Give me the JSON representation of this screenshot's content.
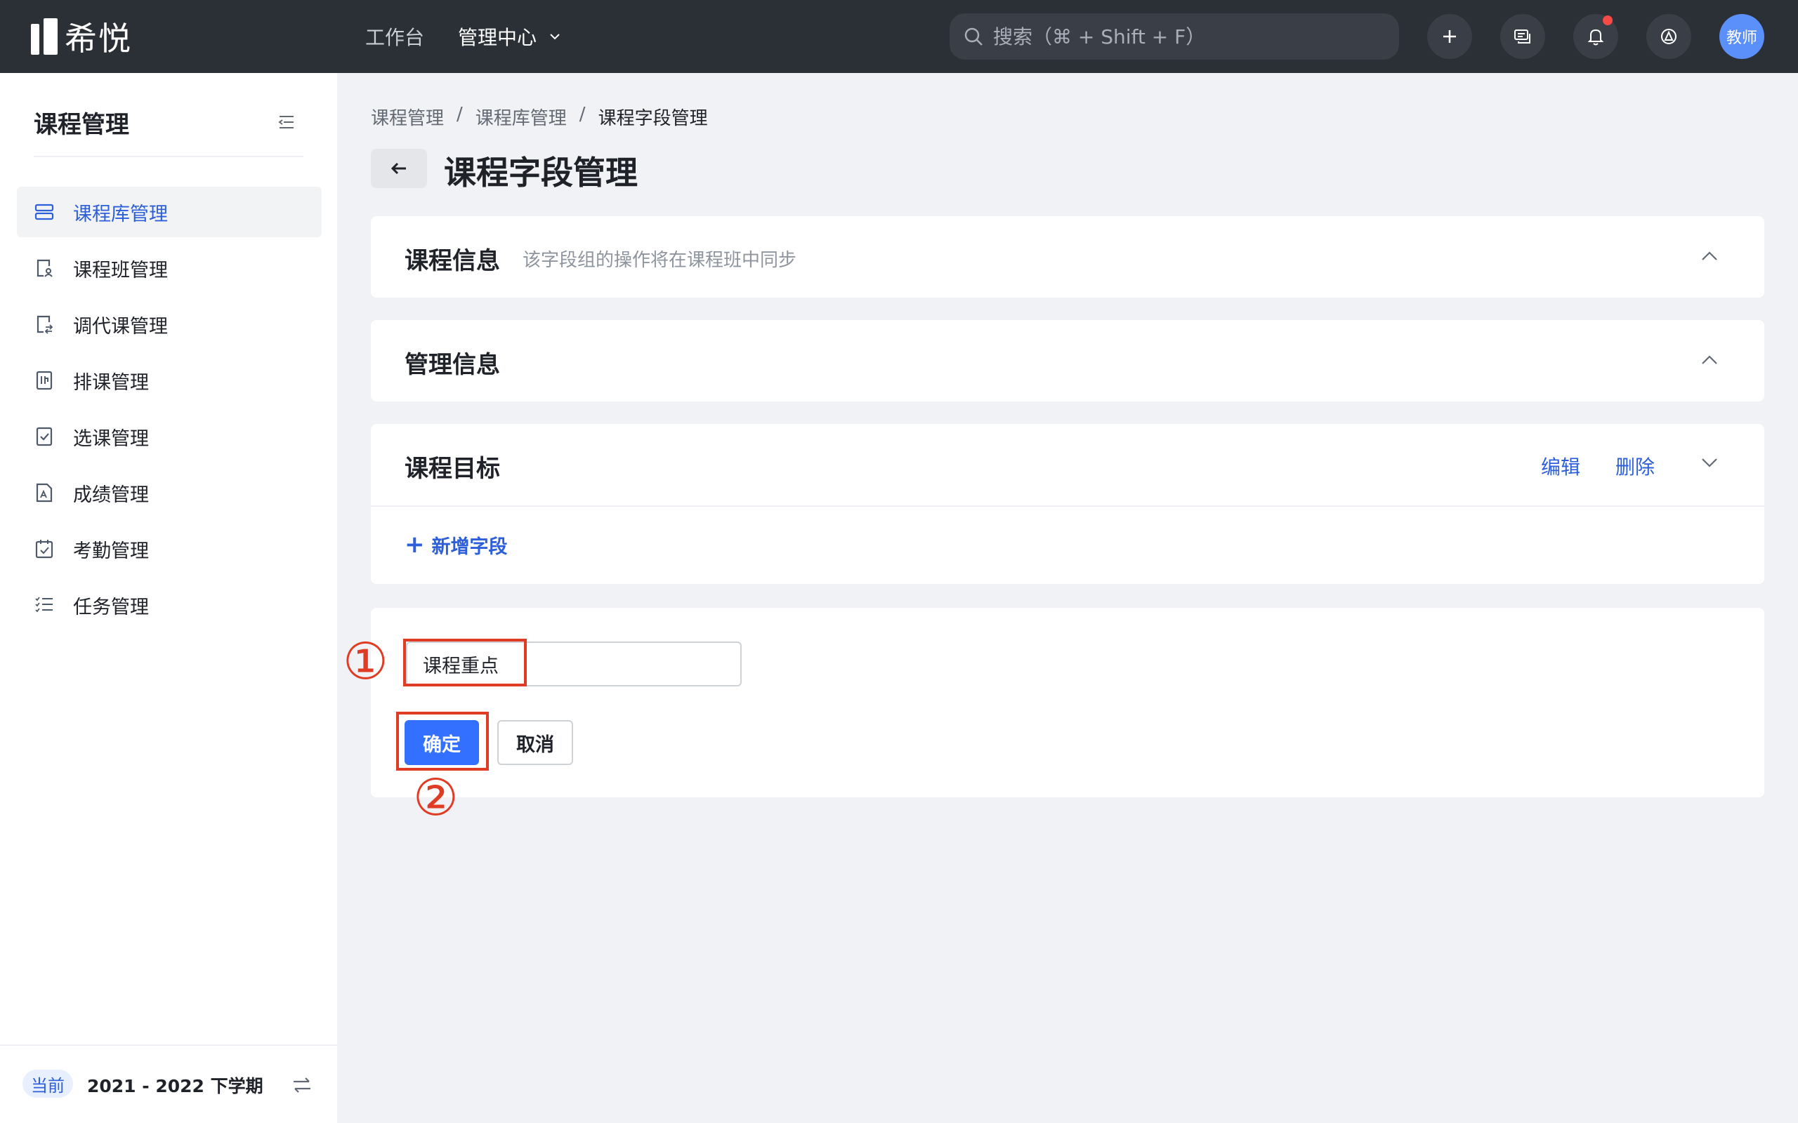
{
  "app": {
    "logo_text": "希悦"
  },
  "topnav": {
    "workbench": "工作台",
    "admin_center": "管理中心"
  },
  "search": {
    "placeholder": "搜索（⌘ + Shift + F）"
  },
  "user": {
    "avatar_label": "教师"
  },
  "sidebar": {
    "title": "课程管理",
    "items": [
      {
        "label": "课程库管理",
        "icon": "course-library-icon",
        "active": true
      },
      {
        "label": "课程班管理",
        "icon": "course-class-icon"
      },
      {
        "label": "调代课管理",
        "icon": "substitute-icon"
      },
      {
        "label": "排课管理",
        "icon": "schedule-icon"
      },
      {
        "label": "选课管理",
        "icon": "course-select-icon"
      },
      {
        "label": "成绩管理",
        "icon": "grades-icon"
      },
      {
        "label": "考勤管理",
        "icon": "attendance-icon"
      },
      {
        "label": "任务管理",
        "icon": "task-list-icon"
      }
    ],
    "term_badge": "当前",
    "term": "2021 - 2022 下学期"
  },
  "breadcrumb": {
    "level1": "课程管理",
    "level2": "课程库管理",
    "level3": "课程字段管理",
    "separator": "/"
  },
  "page": {
    "title": "课程字段管理"
  },
  "cards": {
    "course_info": {
      "title": "课程信息",
      "subtitle": "该字段组的操作将在课程班中同步"
    },
    "admin_info": {
      "title": "管理信息"
    },
    "course_goal": {
      "title": "课程目标",
      "edit": "编辑",
      "delete": "删除",
      "add_field": "新增字段"
    }
  },
  "new_group": {
    "input_value": "课程重点",
    "confirm": "确定",
    "cancel": "取消"
  },
  "annotations": {
    "step1": "①",
    "step2": "②"
  },
  "colors": {
    "primary": "#3370ff",
    "link": "#2c5fd9",
    "annotation": "#e03b24",
    "topbar": "#2b2f36"
  }
}
